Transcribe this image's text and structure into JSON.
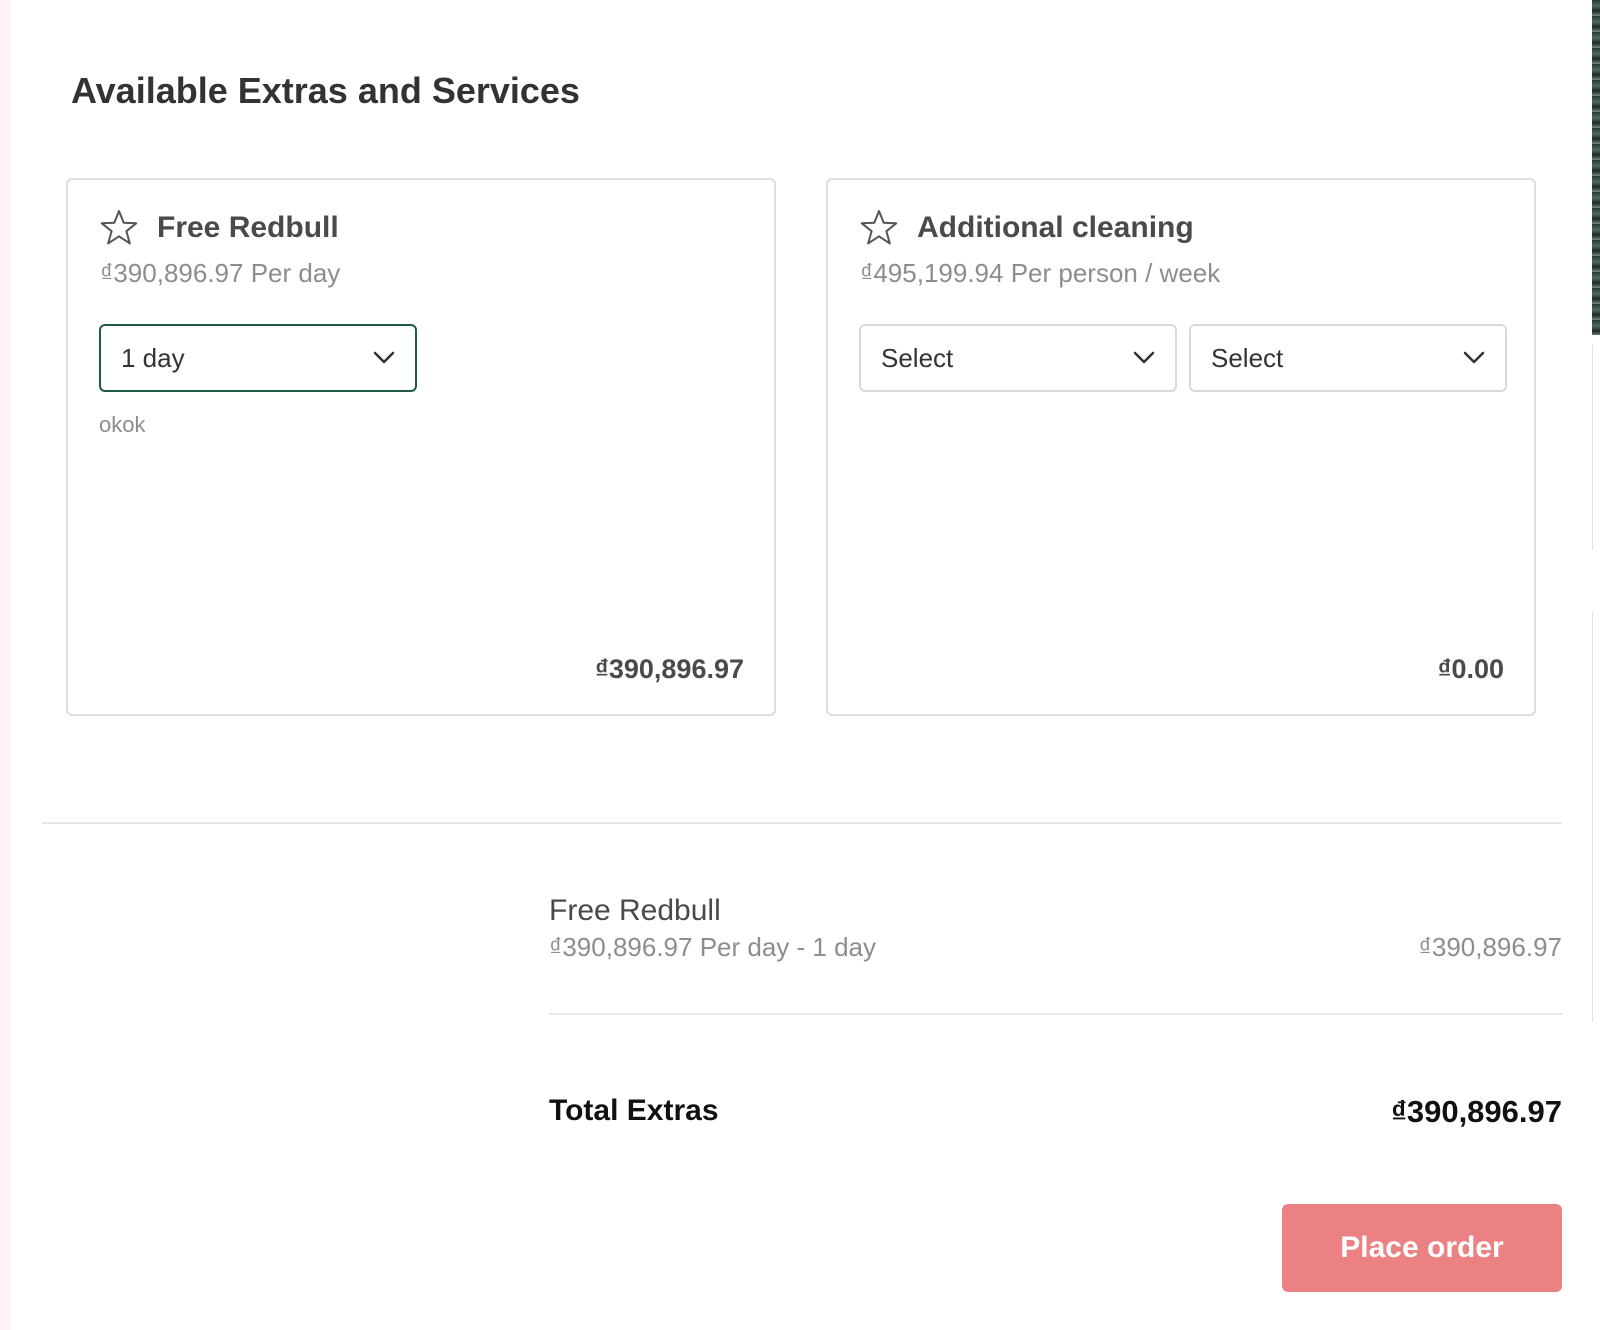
{
  "page": {
    "title": "Available Extras and Services"
  },
  "extras": [
    {
      "title": "Free Redbull",
      "price_text": "₫390,896.97 Per day",
      "selects": [
        {
          "value": "1 day",
          "active": true
        }
      ],
      "note": "okok",
      "total": "₫390,896.97"
    },
    {
      "title": "Additional cleaning",
      "price_text": "₫495,199.94 Per person / week",
      "selects": [
        {
          "value": "Select",
          "active": false
        },
        {
          "value": "Select",
          "active": false
        }
      ],
      "note": "",
      "total": "₫0.00"
    }
  ],
  "summary": {
    "items": [
      {
        "name": "Free Redbull",
        "detail": "₫390,896.97 Per day - 1 day",
        "price": "₫390,896.97"
      }
    ],
    "total_label": "Total Extras",
    "total_value": "₫390,896.97"
  },
  "actions": {
    "place_order_label": "Place order"
  },
  "colors": {
    "accent_border": "#1e5a45",
    "button_bg": "#ec8183",
    "muted_text": "#8d8d8d"
  },
  "icons": {
    "favorite": "star-outline-icon",
    "dropdown": "chevron-down-icon"
  }
}
